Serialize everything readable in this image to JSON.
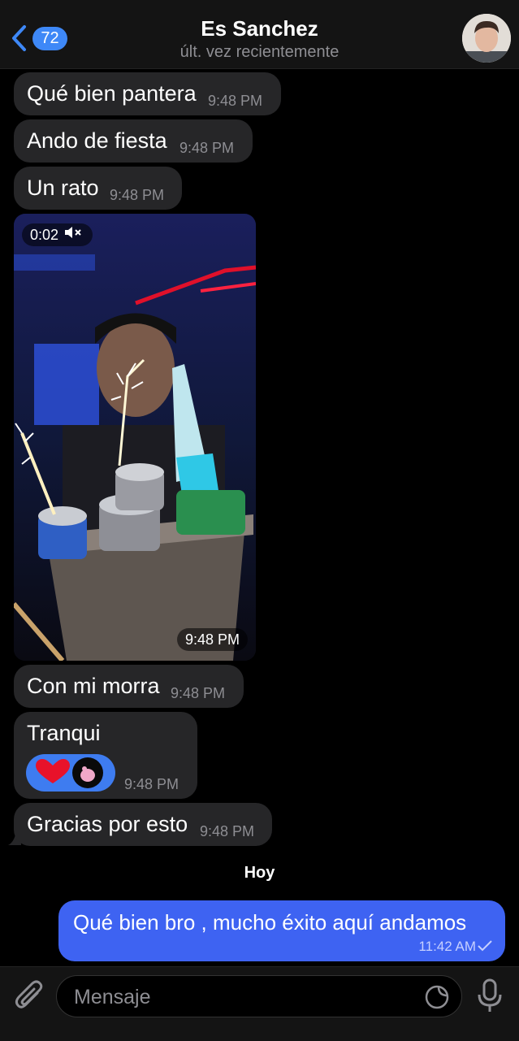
{
  "header": {
    "unread_count": "72",
    "title": "Es Sanchez",
    "subtitle": "últ. vez recientemente"
  },
  "messages": [
    {
      "text": "Qué bien pantera",
      "time": "9:48 PM"
    },
    {
      "text": "Ando de fiesta",
      "time": "9:48 PM"
    },
    {
      "text": "Un rato",
      "time": "9:48 PM"
    },
    {
      "video_duration": "0:02",
      "time": "9:48 PM"
    },
    {
      "text": "Con mi morra",
      "time": "9:48 PM"
    },
    {
      "text": "Tranqui",
      "time": "9:48 PM"
    },
    {
      "text": "Gracias por esto",
      "time": "9:48 PM"
    }
  ],
  "date_separator": "Hoy",
  "outgoing": {
    "text": "Qué bien bro , mucho éxito aquí andamos",
    "time": "11:42 AM"
  },
  "composer": {
    "placeholder": "Mensaje"
  },
  "colors": {
    "accent": "#3e88f7",
    "outgoing_bubble": "#3e63f2",
    "incoming_bubble": "#262628"
  }
}
